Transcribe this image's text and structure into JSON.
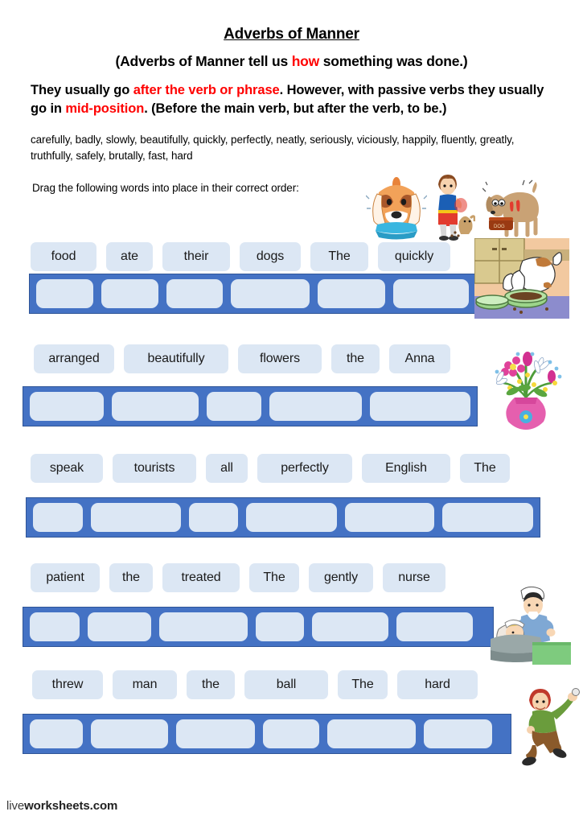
{
  "worksheet": {
    "title": "Adverbs of Manner",
    "subtitle_part1": "(Adverbs of Manner tell us ",
    "subtitle_highlight": "how",
    "subtitle_part2": " something was done.)",
    "rule_1": "They usually go ",
    "rule_red_1": "after the verb or phrase",
    "rule_2": ". However, with ",
    "rule_bold_1": "passive verbs",
    "rule_3": " they usually go in ",
    "rule_red_2": "mid-position",
    "rule_4": ". (Before the main verb, but after the verb, to be.)",
    "adverb_list": "carefully, badly, slowly, beautifully, quickly, perfectly, neatly, seriously, viciously, happily, fluently, greatly, truthfully, safely, brutally, fast, hard",
    "instruction": "Drag the following words into place in their correct order:",
    "footer_light": "live",
    "footer_bold": "worksheets.com"
  },
  "colors": {
    "chip_fill": "#dce7f4",
    "bar_fill": "#4472c4",
    "bar_border": "#2f5597",
    "accent_red": "#ff0000",
    "text": "#000000"
  },
  "exercises": [
    {
      "id": "exercise-1",
      "words": [
        "food",
        "ate",
        "their",
        "dogs",
        "The",
        "quickly"
      ],
      "chip_widths": [
        82,
        58,
        84,
        76,
        72,
        90
      ],
      "chip_gaps": [
        0,
        12,
        12,
        12,
        12,
        12
      ],
      "slot_widths": [
        73,
        73,
        73,
        100,
        87,
        97
      ],
      "image": "dog-eating-from-bowl"
    },
    {
      "id": "exercise-2",
      "words": [
        "arranged",
        "beautifully",
        "flowers",
        "the",
        "Anna"
      ],
      "chip_widths": [
        100,
        130,
        104,
        60,
        76
      ],
      "chip_gaps": [
        0,
        12,
        12,
        12,
        12
      ],
      "slot_widths": [
        97,
        115,
        72,
        122,
        132
      ],
      "image": "vase-of-flowers"
    },
    {
      "id": "exercise-3",
      "words": [
        "speak",
        "tourists",
        "all",
        "perfectly",
        "English",
        "The"
      ],
      "chip_widths": [
        90,
        104,
        52,
        118,
        110,
        62
      ],
      "chip_gaps": [
        0,
        12,
        12,
        12,
        12,
        12
      ],
      "slot_widths": [
        62,
        113,
        62,
        113,
        112,
        114
      ],
      "image": "none"
    },
    {
      "id": "exercise-4",
      "words": [
        "patient",
        "the",
        "treated",
        "The",
        "gently",
        "nurse"
      ],
      "chip_widths": [
        86,
        54,
        96,
        62,
        80,
        78
      ],
      "chip_gaps": [
        0,
        12,
        12,
        12,
        12,
        12
      ],
      "slot_widths": [
        62,
        79,
        110,
        60,
        95,
        95
      ],
      "image": "nurse-treating-patient"
    },
    {
      "id": "exercise-5",
      "words": [
        "threw",
        "man",
        "the",
        "ball",
        "The",
        "hard"
      ],
      "chip_widths": [
        88,
        80,
        60,
        104,
        62,
        100
      ],
      "chip_gaps": [
        0,
        12,
        12,
        12,
        12,
        12
      ],
      "slot_widths": [
        66,
        96,
        98,
        70,
        110,
        85
      ],
      "image": "boy-throwing-ball"
    }
  ],
  "header_images": [
    {
      "name": "sad-dog-with-bowl"
    },
    {
      "name": "boy-feeding-puppy"
    },
    {
      "name": "scared-dog-at-bowl"
    }
  ]
}
